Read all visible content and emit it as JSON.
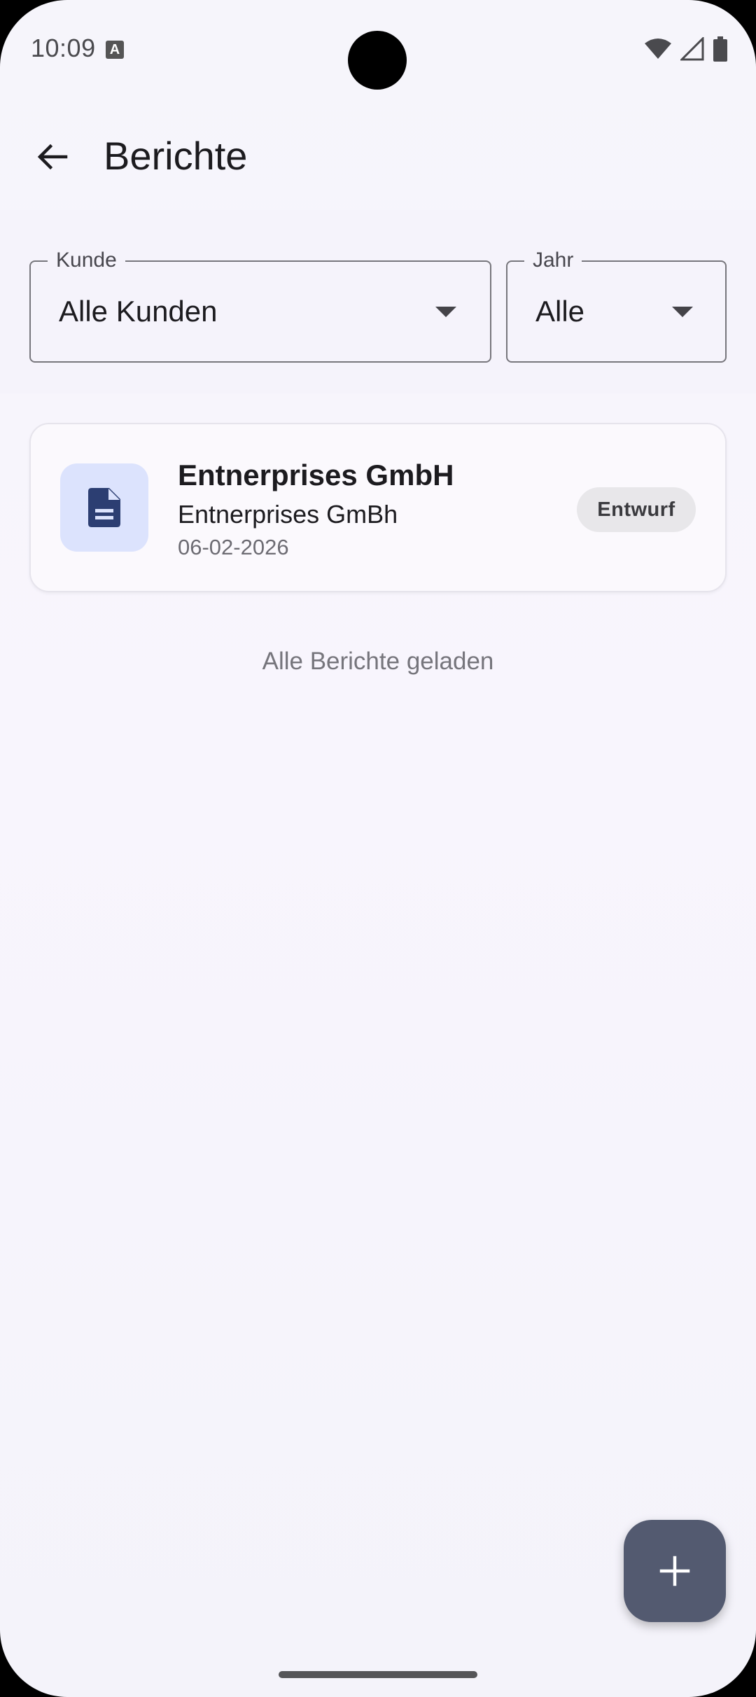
{
  "status_bar": {
    "time": "10:09",
    "notification_icon_letter": "A",
    "icons": [
      "wifi-icon",
      "signal-icon",
      "battery-icon"
    ]
  },
  "app_bar": {
    "title": "Berichte",
    "back_icon": "arrow-back-icon"
  },
  "filters": {
    "customer": {
      "label": "Kunde",
      "value": "Alle Kunden"
    },
    "year": {
      "label": "Jahr",
      "value": "Alle"
    }
  },
  "reports": [
    {
      "title": "Entnerprises GmbH",
      "subtitle": "Entnerprises GmBh",
      "date": "06-02-2026",
      "status": "Entwurf",
      "icon": "document-icon"
    }
  ],
  "list_footer": "Alle Berichte geladen",
  "fab": {
    "icon": "plus-icon"
  },
  "colors": {
    "background": "#f6f5fb",
    "doc_tile": "#dce3fd",
    "doc_icon": "#2c3e72",
    "chip": "#e8e7ea",
    "fab": "#535a70"
  }
}
